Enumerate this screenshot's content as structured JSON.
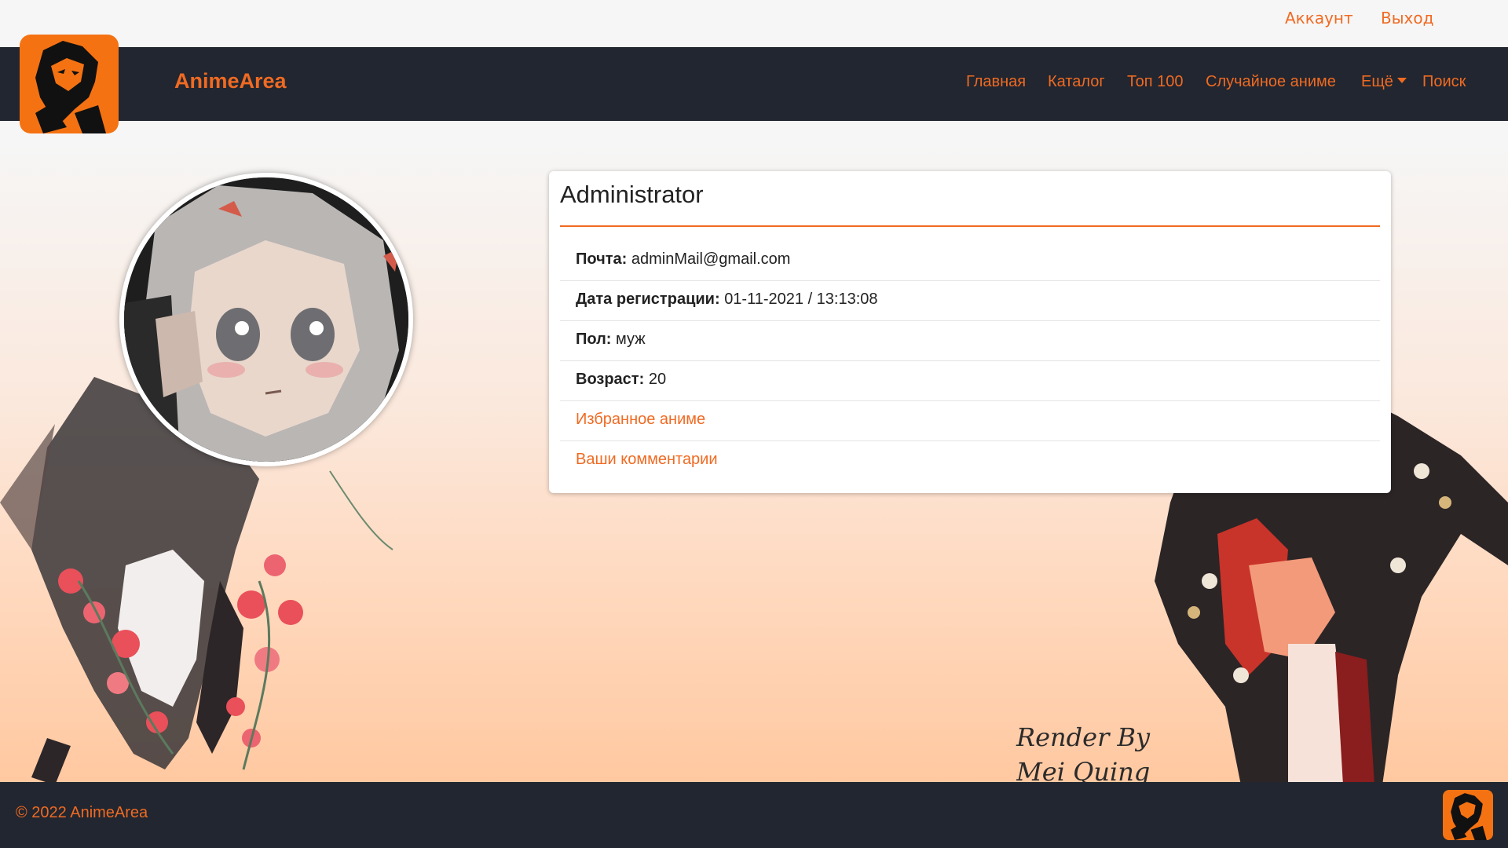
{
  "topbar": {
    "account": "Аккаунт",
    "logout": "Выход"
  },
  "navbar": {
    "brand": "AnimeArea",
    "items": {
      "home": "Главная",
      "catalog": "Каталог",
      "top100": "Топ 100",
      "random": "Случайное аниме",
      "more": "Ещё",
      "search": "Поиск"
    }
  },
  "profile": {
    "name": "Administrator",
    "email_label": "Почта:",
    "email": "adminMail@gmail.com",
    "reg_label": "Дата регистрации:",
    "reg_date": "01-11-2021 / 13:13:08",
    "gender_label": "Пол:",
    "gender": "муж",
    "age_label": "Возраст:",
    "age": "20",
    "favorites": "Избранное аниме",
    "comments": "Ваши комментарии"
  },
  "decor": {
    "signature_line1": "Render By",
    "signature_line2": "Mei Quing"
  },
  "footer": {
    "copyright": "© 2022 AnimeArea"
  },
  "colors": {
    "accent": "#f06a22",
    "navbar_bg": "#212630",
    "logo_bg": "#f57212"
  }
}
